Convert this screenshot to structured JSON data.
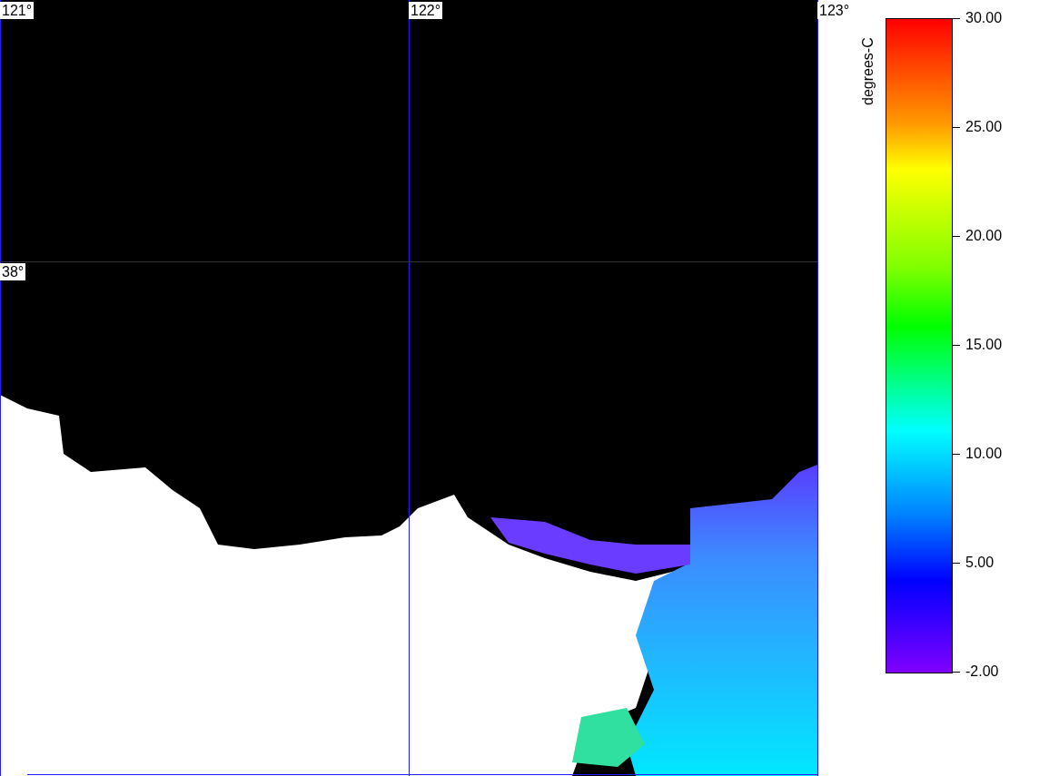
{
  "map": {
    "longitude_labels": [
      "121°",
      "122°",
      "123°"
    ],
    "latitude_labels": [
      "38°"
    ]
  },
  "legend": {
    "unit": "degrees-C",
    "ticks": [
      "30.00",
      "25.00",
      "20.00",
      "15.00",
      "10.00",
      "5.00",
      "-2.00"
    ]
  }
}
